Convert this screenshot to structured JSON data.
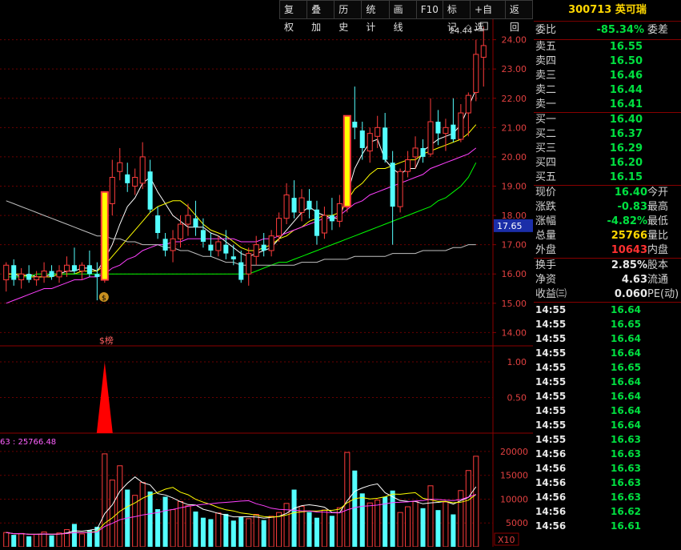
{
  "toolbar": [
    "复权",
    "叠加",
    "历史",
    "统计",
    "画线",
    "F10",
    "标记",
    "+自选",
    "返回"
  ],
  "stock": {
    "code": "300713",
    "name": "英可瑞"
  },
  "main_chart": {
    "price_ticks": [
      "24.00",
      "23.00",
      "22.00",
      "21.00",
      "20.00",
      "19.00",
      "18.00",
      "17.00",
      "16.00",
      "15.00",
      "14.00"
    ],
    "current_marker": "17.65",
    "high_label": "24.44",
    "signal_label": "$榜"
  },
  "indicator": {
    "ticks": [
      "1.00",
      "0.50"
    ]
  },
  "volume": {
    "header": "63 : 25766.48",
    "ticks": [
      "20000",
      "15000",
      "10000",
      "5000"
    ],
    "unit": "X10"
  },
  "quote": {
    "weibi": {
      "label": "委比",
      "value": "-85.34%",
      "label2": "委差"
    },
    "sells": [
      {
        "label": "卖五",
        "price": "16.55"
      },
      {
        "label": "卖四",
        "price": "16.50"
      },
      {
        "label": "卖三",
        "price": "16.46"
      },
      {
        "label": "卖二",
        "price": "16.44"
      },
      {
        "label": "卖一",
        "price": "16.41"
      }
    ],
    "buys": [
      {
        "label": "买一",
        "price": "16.40"
      },
      {
        "label": "买二",
        "price": "16.37"
      },
      {
        "label": "买三",
        "price": "16.29"
      },
      {
        "label": "买四",
        "price": "16.20"
      },
      {
        "label": "买五",
        "price": "16.15"
      }
    ],
    "stats": [
      {
        "label": "现价",
        "value": "16.40",
        "color": "green",
        "label2": "今开"
      },
      {
        "label": "涨跌",
        "value": "-0.83",
        "color": "green",
        "label2": "最高"
      },
      {
        "label": "涨幅",
        "value": "-4.82%",
        "color": "green",
        "label2": "最低"
      },
      {
        "label": "总量",
        "value": "25766",
        "color": "yellow",
        "label2": "量比"
      },
      {
        "label": "外盘",
        "value": "10643",
        "color": "red",
        "label2": "内盘"
      }
    ],
    "fin": [
      {
        "label": "换手",
        "value": "2.85%",
        "label2": "股本"
      },
      {
        "label": "净资",
        "value": "4.63",
        "label2": "流通"
      },
      {
        "label": "收益㈢",
        "value": "0.060",
        "label2": "PE(动)"
      }
    ],
    "ticks": [
      {
        "time": "14:55",
        "price": "16.64"
      },
      {
        "time": "14:55",
        "price": "16.65"
      },
      {
        "time": "14:55",
        "price": "16.64"
      },
      {
        "time": "14:55",
        "price": "16.64"
      },
      {
        "time": "14:55",
        "price": "16.65"
      },
      {
        "time": "14:55",
        "price": "16.64"
      },
      {
        "time": "14:55",
        "price": "16.64"
      },
      {
        "time": "14:55",
        "price": "16.64"
      },
      {
        "time": "14:55",
        "price": "16.64"
      },
      {
        "time": "14:55",
        "price": "16.63"
      },
      {
        "time": "14:56",
        "price": "16.63"
      },
      {
        "time": "14:56",
        "price": "16.63"
      },
      {
        "time": "14:56",
        "price": "16.63"
      },
      {
        "time": "14:56",
        "price": "16.63"
      },
      {
        "time": "14:56",
        "price": "16.62"
      },
      {
        "time": "14:56",
        "price": "16.61"
      }
    ]
  },
  "chart_data": {
    "type": "candlestick",
    "candles": [
      {
        "o": 15.8,
        "h": 16.4,
        "l": 15.4,
        "c": 16.3
      },
      {
        "o": 16.3,
        "h": 16.5,
        "l": 15.6,
        "c": 15.8
      },
      {
        "o": 15.8,
        "h": 16.2,
        "l": 15.5,
        "c": 16.0
      },
      {
        "o": 16.0,
        "h": 16.3,
        "l": 15.7,
        "c": 15.8
      },
      {
        "o": 15.8,
        "h": 16.1,
        "l": 15.6,
        "c": 15.9
      },
      {
        "o": 15.9,
        "h": 16.4,
        "l": 15.7,
        "c": 16.1
      },
      {
        "o": 16.1,
        "h": 16.3,
        "l": 15.8,
        "c": 15.9
      },
      {
        "o": 15.9,
        "h": 16.3,
        "l": 15.7,
        "c": 16.1
      },
      {
        "o": 16.1,
        "h": 16.6,
        "l": 15.9,
        "c": 16.3
      },
      {
        "o": 16.3,
        "h": 16.9,
        "l": 16.0,
        "c": 16.1
      },
      {
        "o": 16.1,
        "h": 16.4,
        "l": 15.8,
        "c": 16.3
      },
      {
        "o": 16.3,
        "h": 16.8,
        "l": 15.9,
        "c": 16.0
      },
      {
        "o": 16.0,
        "h": 16.4,
        "l": 15.1,
        "c": 15.9
      },
      {
        "o": 15.8,
        "h": 18.8,
        "l": 15.7,
        "c": 18.8
      },
      {
        "o": 18.4,
        "h": 19.9,
        "l": 18.0,
        "c": 19.3
      },
      {
        "o": 19.5,
        "h": 20.3,
        "l": 19.2,
        "c": 19.8
      },
      {
        "o": 19.4,
        "h": 19.8,
        "l": 18.8,
        "c": 19.1
      },
      {
        "o": 19.0,
        "h": 19.6,
        "l": 18.7,
        "c": 19.3
      },
      {
        "o": 19.1,
        "h": 20.5,
        "l": 18.9,
        "c": 20.0
      },
      {
        "o": 19.5,
        "h": 19.9,
        "l": 18.1,
        "c": 18.2
      },
      {
        "o": 18.0,
        "h": 18.3,
        "l": 17.2,
        "c": 17.4
      },
      {
        "o": 17.2,
        "h": 17.4,
        "l": 16.6,
        "c": 16.8
      },
      {
        "o": 16.8,
        "h": 17.5,
        "l": 16.4,
        "c": 17.2
      },
      {
        "o": 17.2,
        "h": 18.0,
        "l": 16.9,
        "c": 17.7
      },
      {
        "o": 17.7,
        "h": 18.4,
        "l": 17.3,
        "c": 18.0
      },
      {
        "o": 17.9,
        "h": 18.5,
        "l": 17.3,
        "c": 17.6
      },
      {
        "o": 17.5,
        "h": 17.9,
        "l": 16.9,
        "c": 17.1
      },
      {
        "o": 17.0,
        "h": 17.4,
        "l": 16.6,
        "c": 16.8
      },
      {
        "o": 16.8,
        "h": 17.3,
        "l": 16.6,
        "c": 17.1
      },
      {
        "o": 17.0,
        "h": 17.5,
        "l": 16.5,
        "c": 16.7
      },
      {
        "o": 16.6,
        "h": 17.0,
        "l": 16.3,
        "c": 16.5
      },
      {
        "o": 16.4,
        "h": 16.8,
        "l": 15.7,
        "c": 15.8
      },
      {
        "o": 16.0,
        "h": 16.9,
        "l": 15.6,
        "c": 16.7
      },
      {
        "o": 16.6,
        "h": 17.3,
        "l": 16.3,
        "c": 17.0
      },
      {
        "o": 17.0,
        "h": 17.4,
        "l": 16.6,
        "c": 16.8
      },
      {
        "o": 16.8,
        "h": 17.5,
        "l": 16.6,
        "c": 17.3
      },
      {
        "o": 17.3,
        "h": 18.1,
        "l": 17.1,
        "c": 17.9
      },
      {
        "o": 17.9,
        "h": 19.1,
        "l": 17.7,
        "c": 18.7
      },
      {
        "o": 18.6,
        "h": 19.2,
        "l": 17.9,
        "c": 18.1
      },
      {
        "o": 18.1,
        "h": 18.9,
        "l": 17.8,
        "c": 18.6
      },
      {
        "o": 18.5,
        "h": 18.9,
        "l": 17.9,
        "c": 18.2
      },
      {
        "o": 18.2,
        "h": 18.5,
        "l": 17.0,
        "c": 17.3
      },
      {
        "o": 17.4,
        "h": 18.3,
        "l": 17.2,
        "c": 18.0
      },
      {
        "o": 18.0,
        "h": 18.6,
        "l": 17.5,
        "c": 17.8
      },
      {
        "o": 17.8,
        "h": 18.7,
        "l": 17.6,
        "c": 18.4
      },
      {
        "o": 18.3,
        "h": 21.4,
        "l": 18.1,
        "c": 21.4
      },
      {
        "o": 21.2,
        "h": 22.4,
        "l": 20.6,
        "c": 21.0
      },
      {
        "o": 20.9,
        "h": 21.2,
        "l": 19.9,
        "c": 20.3
      },
      {
        "o": 20.2,
        "h": 21.0,
        "l": 19.8,
        "c": 20.8
      },
      {
        "o": 20.7,
        "h": 21.4,
        "l": 20.3,
        "c": 21.0
      },
      {
        "o": 21.0,
        "h": 21.5,
        "l": 19.8,
        "c": 19.9
      },
      {
        "o": 19.8,
        "h": 20.2,
        "l": 17.0,
        "c": 18.3
      },
      {
        "o": 18.3,
        "h": 19.6,
        "l": 18.1,
        "c": 19.5
      },
      {
        "o": 19.5,
        "h": 20.2,
        "l": 19.3,
        "c": 19.9
      },
      {
        "o": 20.0,
        "h": 20.7,
        "l": 19.6,
        "c": 20.3
      },
      {
        "o": 20.3,
        "h": 20.6,
        "l": 19.8,
        "c": 20.0
      },
      {
        "o": 20.1,
        "h": 22.0,
        "l": 20.0,
        "c": 21.2
      },
      {
        "o": 21.2,
        "h": 21.6,
        "l": 20.4,
        "c": 20.8
      },
      {
        "o": 20.8,
        "h": 21.3,
        "l": 20.2,
        "c": 21.0
      },
      {
        "o": 21.1,
        "h": 22.0,
        "l": 20.5,
        "c": 20.6
      },
      {
        "o": 20.6,
        "h": 21.8,
        "l": 20.5,
        "c": 21.5
      },
      {
        "o": 21.5,
        "h": 22.2,
        "l": 20.7,
        "c": 22.1
      },
      {
        "o": 22.2,
        "h": 24.0,
        "l": 21.9,
        "c": 23.5
      },
      {
        "o": 23.4,
        "h": 24.44,
        "l": 22.4,
        "c": 23.8
      }
    ],
    "ma": [
      {
        "color": "#ffffff",
        "values": [
          16.0,
          16.0,
          15.9,
          16.0,
          15.9,
          15.9,
          16.0,
          16.0,
          16.1,
          16.1,
          16.2,
          16.2,
          16.1,
          16.5,
          17.0,
          17.7,
          18.3,
          18.6,
          19.1,
          19.3,
          18.8,
          18.4,
          18.0,
          17.8,
          17.6,
          17.6,
          17.6,
          17.4,
          17.3,
          17.1,
          16.9,
          16.7,
          16.6,
          16.7,
          16.8,
          16.9,
          17.2,
          17.5,
          17.8,
          18.1,
          18.3,
          18.1,
          18.0,
          17.9,
          17.9,
          18.7,
          19.6,
          20.1,
          20.5,
          20.6,
          19.9,
          19.6,
          19.4,
          19.6,
          19.6,
          20.2,
          20.4,
          20.6,
          20.7,
          20.8,
          21.1,
          21.7,
          22.3
        ]
      },
      {
        "color": "#ffff00",
        "values": [
          16.0,
          16.0,
          16.0,
          15.9,
          15.9,
          15.9,
          15.9,
          16.0,
          16.0,
          16.0,
          16.1,
          16.1,
          16.1,
          16.3,
          16.6,
          16.9,
          17.2,
          17.5,
          17.8,
          18.1,
          18.3,
          18.4,
          18.5,
          18.5,
          18.3,
          18.0,
          17.7,
          17.5,
          17.4,
          17.3,
          17.1,
          16.9,
          16.8,
          16.8,
          16.9,
          17.0,
          17.2,
          17.3,
          17.5,
          17.6,
          17.8,
          17.9,
          18.0,
          18.0,
          18.1,
          18.5,
          18.9,
          19.1,
          19.4,
          19.6,
          19.6,
          19.7,
          19.8,
          19.9,
          19.9,
          20.1,
          20.2,
          20.3,
          20.4,
          20.5,
          20.6,
          20.8,
          21.1
        ]
      },
      {
        "color": "#ff40ff",
        "values": [
          15.0,
          15.1,
          15.2,
          15.3,
          15.4,
          15.5,
          15.5,
          15.6,
          15.7,
          15.8,
          15.8,
          15.9,
          15.9,
          16.0,
          16.2,
          16.3,
          16.5,
          16.6,
          16.8,
          16.9,
          17.0,
          17.0,
          17.1,
          17.1,
          17.2,
          17.2,
          17.2,
          17.2,
          17.2,
          17.2,
          17.2,
          17.1,
          17.1,
          17.1,
          17.2,
          17.2,
          17.3,
          17.4,
          17.5,
          17.6,
          17.7,
          17.8,
          17.9,
          17.9,
          18.0,
          18.2,
          18.4,
          18.5,
          18.7,
          18.8,
          18.9,
          19.0,
          19.1,
          19.2,
          19.3,
          19.4,
          19.6,
          19.7,
          19.8,
          19.9,
          20.0,
          20.1,
          20.3
        ]
      },
      {
        "color": "#00ff00",
        "values": [
          15.9,
          15.9,
          15.9,
          15.9,
          16.0,
          16.0,
          16.0,
          16.0,
          16.0,
          16.0,
          16.0,
          16.0,
          16.0,
          16.0,
          16.0,
          16.0,
          16.0,
          16.0,
          16.0,
          16.0,
          16.0,
          16.0,
          16.0,
          16.0,
          16.0,
          16.0,
          16.0,
          16.0,
          16.0,
          16.0,
          16.0,
          16.0,
          16.0,
          16.1,
          16.2,
          16.3,
          16.4,
          16.4,
          16.5,
          16.6,
          16.7,
          16.8,
          16.9,
          17.0,
          17.1,
          17.2,
          17.3,
          17.4,
          17.5,
          17.6,
          17.7,
          17.8,
          17.9,
          18.0,
          18.1,
          18.2,
          18.3,
          18.5,
          18.6,
          18.8,
          19.0,
          19.3,
          19.8
        ]
      },
      {
        "color": "#c0c0c0",
        "values": [
          18.5,
          18.4,
          18.3,
          18.2,
          18.1,
          18.0,
          17.9,
          17.8,
          17.7,
          17.6,
          17.5,
          17.4,
          17.3,
          17.3,
          17.2,
          17.2,
          17.1,
          17.1,
          17.0,
          17.0,
          17.0,
          16.9,
          16.9,
          16.8,
          16.8,
          16.7,
          16.6,
          16.6,
          16.5,
          16.4,
          16.4,
          16.3,
          16.3,
          16.3,
          16.3,
          16.3,
          16.3,
          16.3,
          16.3,
          16.4,
          16.4,
          16.4,
          16.5,
          16.5,
          16.5,
          16.5,
          16.6,
          16.6,
          16.6,
          16.6,
          16.6,
          16.7,
          16.7,
          16.7,
          16.7,
          16.8,
          16.8,
          16.8,
          16.8,
          16.9,
          16.9,
          17.0,
          17.0
        ]
      }
    ],
    "volume": [
      3000,
      2500,
      2800,
      2200,
      2600,
      3100,
      2400,
      2900,
      3600,
      4800,
      2700,
      3500,
      4200,
      19500,
      14000,
      17000,
      12000,
      10800,
      13500,
      11600,
      7900,
      10500,
      7800,
      9500,
      8600,
      7400,
      6100,
      5800,
      7100,
      6900,
      5500,
      6200,
      5900,
      6800,
      5600,
      6400,
      7200,
      9100,
      12000,
      8500,
      7300,
      6100,
      7700,
      6500,
      8200,
      19800,
      16000,
      11200,
      9200,
      9800,
      10500,
      11800,
      7200,
      8400,
      9600,
      8100,
      12800,
      7700,
      9400,
      6800,
      11800,
      16000,
      19000
    ],
    "indicator": {
      "index": 13,
      "value": 1.0
    },
    "price_range": [
      13.6,
      24.7
    ]
  }
}
